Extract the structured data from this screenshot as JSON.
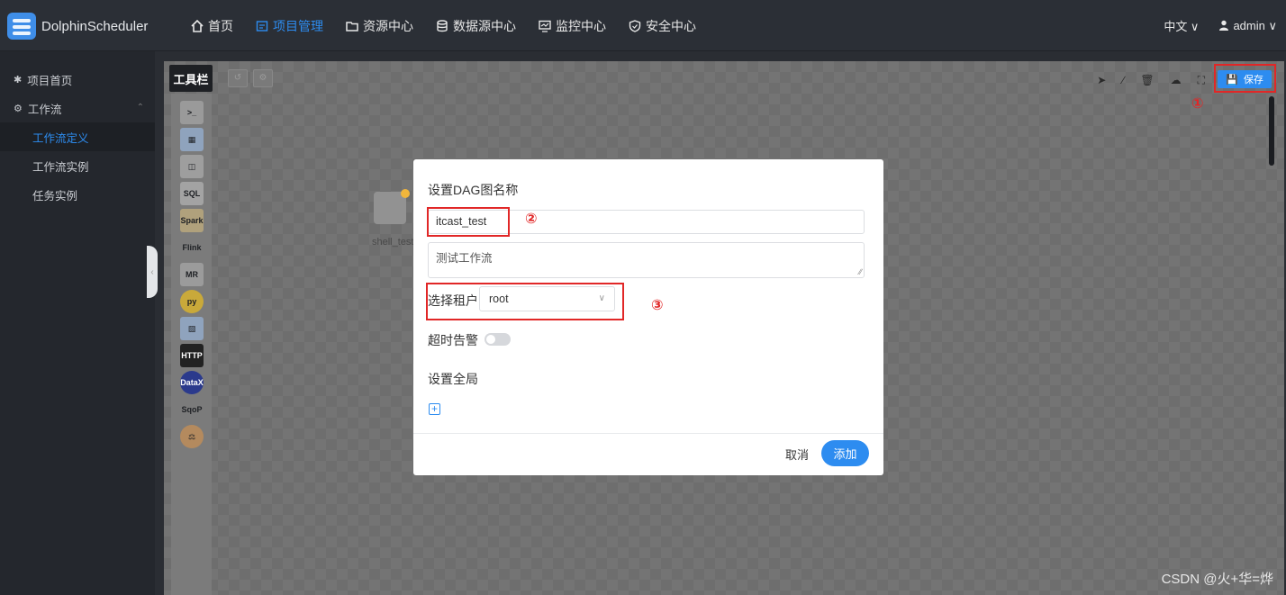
{
  "app": {
    "title": "DolphinScheduler"
  },
  "nav": {
    "items": [
      {
        "label": "首页",
        "icon": "home-icon"
      },
      {
        "label": "项目管理",
        "icon": "project-icon"
      },
      {
        "label": "资源中心",
        "icon": "folder-icon"
      },
      {
        "label": "数据源中心",
        "icon": "database-icon"
      },
      {
        "label": "监控中心",
        "icon": "monitor-icon"
      },
      {
        "label": "安全中心",
        "icon": "shield-icon"
      }
    ],
    "active": "项目管理",
    "language": "中文 ∨",
    "user": "admin ∨"
  },
  "sidebar": {
    "project_home": "项目首页",
    "workflow_group": "工作流",
    "items": [
      "工作流定义",
      "工作流实例",
      "任务实例"
    ]
  },
  "toolbar": {
    "label": "工具栏",
    "save_label": "保存"
  },
  "tools": [
    "SHELL",
    "SUB_PROCESS",
    "PROCEDURE",
    "SQL",
    "SPARK",
    "FLINK",
    "MR",
    "PYTHON",
    "DEPENDENT",
    "HTTP",
    "DATAX",
    "SQOOP",
    "CONDITIONS"
  ],
  "node": {
    "label": "shell_test"
  },
  "annotations": {
    "one": "①",
    "two": "②",
    "three": "③"
  },
  "modal": {
    "title": "设置DAG图名称",
    "name_value": "itcast_test",
    "description_value": "测试工作流",
    "tenant_label": "选择租户",
    "tenant_value": "root",
    "timeout_label": "超时告警",
    "global_label": "设置全局",
    "cancel_label": "取消",
    "add_label": "添加"
  },
  "watermark": "CSDN @火+华=烨",
  "colors": {
    "accent": "#2d8cf0",
    "annotation": "#e12727",
    "topbar": "#2b2f36"
  }
}
